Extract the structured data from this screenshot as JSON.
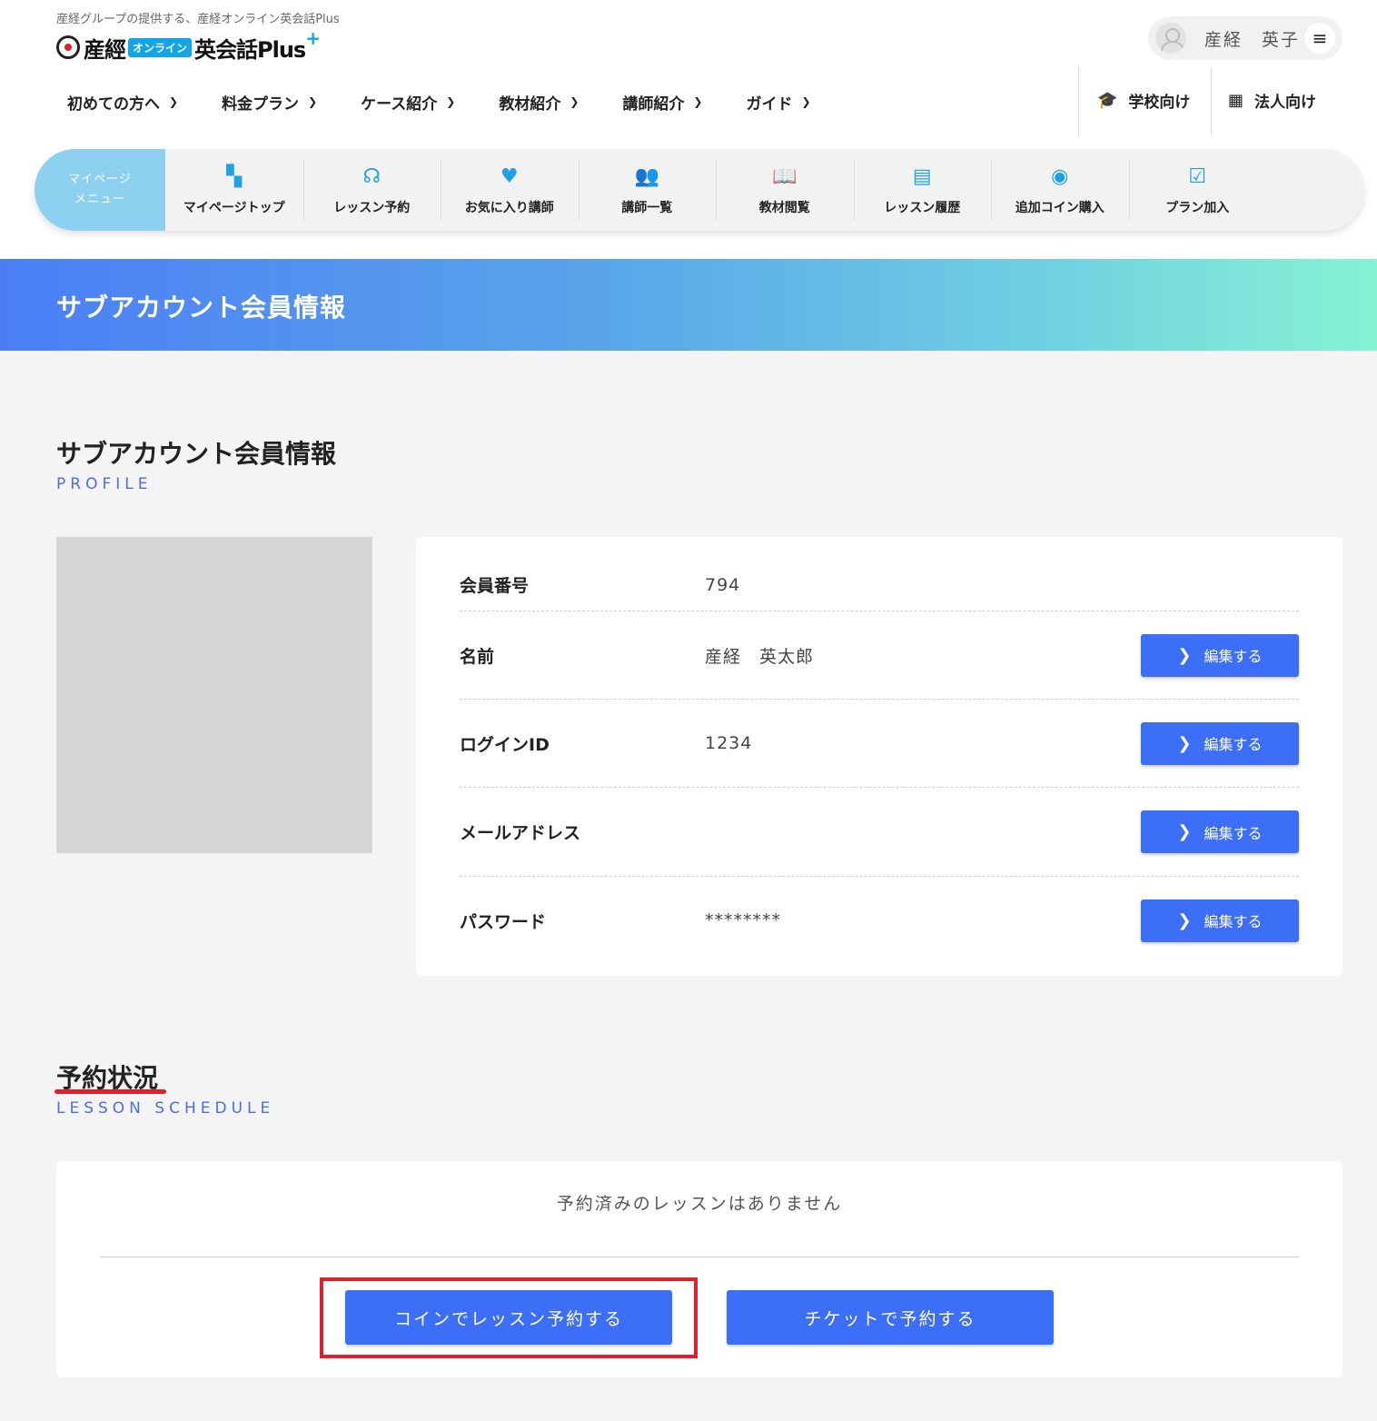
{
  "header": {
    "tagline": "産経グループの提供する、産経オンライン英会話Plus",
    "logo": {
      "part1": "産經",
      "badge": "オンライン",
      "part2": "英会話Plus",
      "plus": "+"
    },
    "user_name": "産経　英子",
    "menu_icon": "≡"
  },
  "gnav": {
    "items": [
      "初めての方へ",
      "料金プラン",
      "ケース紹介",
      "教材紹介",
      "講師紹介",
      "ガイド"
    ],
    "school": "学校向け",
    "corporate": "法人向け"
  },
  "mymenu": {
    "label_line1": "マイページ",
    "label_line2": "メニュー",
    "items": [
      {
        "label": "マイページトップ",
        "icon": "dashboard-icon"
      },
      {
        "label": "レッスン予約",
        "icon": "headset-icon"
      },
      {
        "label": "お気に入り講師",
        "icon": "heart-icon"
      },
      {
        "label": "講師一覧",
        "icon": "people-icon"
      },
      {
        "label": "教材閲覧",
        "icon": "book-icon"
      },
      {
        "label": "レッスン履歴",
        "icon": "monitor-icon"
      },
      {
        "label": "追加コイン購入",
        "icon": "coin-icon"
      },
      {
        "label": "プラン加入",
        "icon": "clipboard-check-icon"
      }
    ]
  },
  "banner": {
    "title": "サブアカウント会員情報"
  },
  "profile": {
    "title": "サブアカウント会員情報",
    "subtitle": "PROFILE",
    "rows": [
      {
        "label": "会員番号",
        "value": "794"
      },
      {
        "label": "名前",
        "value": "産経　英太郎",
        "button": "編集する"
      },
      {
        "label": "ログインID",
        "value": "1234",
        "button": "編集する"
      },
      {
        "label": "メールアドレス",
        "value": "",
        "button": "編集する"
      },
      {
        "label": "パスワード",
        "value": "********",
        "button": "編集する"
      }
    ]
  },
  "schedule": {
    "title": "予約状況",
    "subtitle": "LESSON SCHEDULE",
    "empty": "予約済みのレッスンはありません",
    "coin_button": "コインでレッスン予約する",
    "ticket_button": "チケットで予約する"
  },
  "colors": {
    "accent": "#3d6ef7",
    "sky": "#1da1e8",
    "highlight": "#e0202a"
  }
}
